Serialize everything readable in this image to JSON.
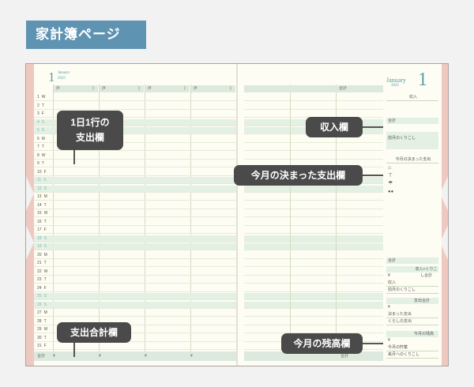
{
  "header": {
    "title": "家計簿ページ"
  },
  "left_page": {
    "month_number": "1",
    "month_name": "January",
    "year": "2025",
    "column_header_yen": "(¥",
    "column_header_paren": ")",
    "days": [
      "1",
      "2",
      "3",
      "4",
      "5",
      "6",
      "7",
      "8",
      "9",
      "10",
      "11",
      "12",
      "13",
      "14",
      "15",
      "16",
      "17",
      "18",
      "19",
      "20",
      "21",
      "22",
      "23",
      "24",
      "25",
      "26",
      "27",
      "28",
      "29",
      "30",
      "31"
    ],
    "weekdays": [
      "W",
      "T",
      "F",
      "S",
      "S",
      "M",
      "T",
      "W",
      "T",
      "F",
      "S",
      "S",
      "M",
      "T",
      "W",
      "T",
      "F",
      "S",
      "S",
      "M",
      "T",
      "W",
      "T",
      "F",
      "S",
      "S",
      "M",
      "T",
      "W",
      "T",
      "F"
    ],
    "total_label": "合計",
    "total_yen": "¥"
  },
  "right_page": {
    "month_number": "1",
    "month_name": "January",
    "year": "2025",
    "column_header_total": "合計",
    "total_label": "合計",
    "income_label": "収入",
    "income_total": "合計",
    "prev_balance": "前月のくりこし",
    "fixed_expense_label": "今月の決まった支出",
    "fixed_total": "合計",
    "income_carry_total": "収入+くりこし合計",
    "item_income": "収入",
    "item_prev": "前月のくりこし",
    "expense_total": "支出合計",
    "item_fixed": "決まった支出",
    "item_living": "くらしの支出",
    "balance_label": "今月の残高",
    "item_savings": "今月の貯蓄",
    "item_next": "来月へのくりこし",
    "yen": "¥"
  },
  "callouts": {
    "daily": "1日1行の\n支出欄",
    "expense_total": "支出合計欄",
    "income": "収入欄",
    "fixed_expense": "今月の決まった支出欄",
    "balance": "今月の残高欄"
  },
  "colors": {
    "accent": "#5f93b2",
    "month": "#5b9fa6",
    "highlight_row": "#e4f0e4",
    "tab": "#efc9c0",
    "callout": "#4a4a4a"
  }
}
